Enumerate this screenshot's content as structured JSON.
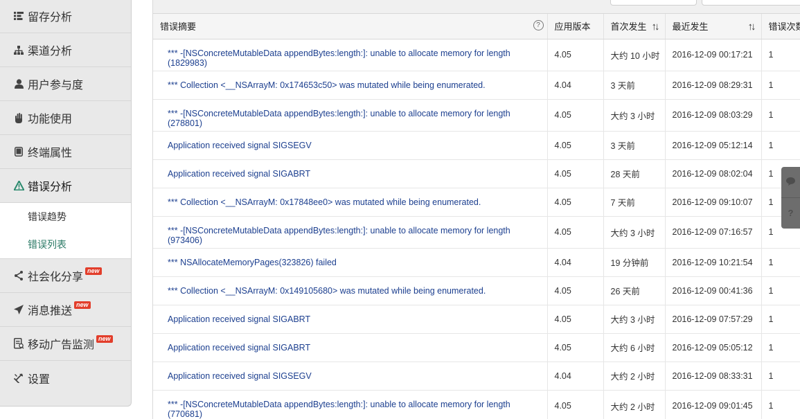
{
  "sidebar": {
    "items": [
      {
        "label": "留存分析",
        "icon": "retention-icon"
      },
      {
        "label": "渠道分析",
        "icon": "channel-icon"
      },
      {
        "label": "用户参与度",
        "icon": "user-icon"
      },
      {
        "label": "功能使用",
        "icon": "hand-icon"
      },
      {
        "label": "终端属性",
        "icon": "tablet-icon"
      },
      {
        "label": "错误分析",
        "icon": "warning-icon"
      }
    ],
    "subitems": [
      {
        "label": "错误趋势"
      },
      {
        "label": "错误列表"
      }
    ],
    "items2": [
      {
        "label": "社会化分享",
        "icon": "share-icon",
        "badge": "new"
      },
      {
        "label": "消息推送",
        "icon": "send-icon",
        "badge": "new"
      },
      {
        "label": "移动广告监测",
        "icon": "ad-monitor-icon",
        "badge": "new"
      },
      {
        "label": "设置",
        "icon": "tools-icon"
      }
    ]
  },
  "table": {
    "headers": {
      "summary": "错误摘要",
      "version": "应用版本",
      "first": "首次发生",
      "last": "最近发生",
      "count": "错误次数"
    },
    "rows": [
      {
        "summary": "*** -[NSConcreteMutableData appendBytes:length:]: unable to allocate memory for length (1829983)",
        "version": "4.05",
        "first": "大约 10 小时",
        "last": "2016-12-09 00:17:21",
        "count": "1"
      },
      {
        "summary": "*** Collection <__NSArrayM: 0x174653c50> was mutated while being enumerated.",
        "version": "4.04",
        "first": "3 天前",
        "last": "2016-12-09 08:29:31",
        "count": "1"
      },
      {
        "summary": "*** -[NSConcreteMutableData appendBytes:length:]: unable to allocate memory for length (278801)",
        "version": "4.05",
        "first": "大约 3 小时",
        "last": "2016-12-09 08:03:29",
        "count": "1"
      },
      {
        "summary": "Application received signal SIGSEGV",
        "version": "4.05",
        "first": "3 天前",
        "last": "2016-12-09 05:12:14",
        "count": "1"
      },
      {
        "summary": "Application received signal SIGABRT",
        "version": "4.05",
        "first": "28 天前",
        "last": "2016-12-09 08:02:04",
        "count": "1"
      },
      {
        "summary": "*** Collection <__NSArrayM: 0x17848ee0> was mutated while being enumerated.",
        "version": "4.05",
        "first": "7 天前",
        "last": "2016-12-09 09:10:07",
        "count": "1"
      },
      {
        "summary": "*** -[NSConcreteMutableData appendBytes:length:]: unable to allocate memory for length (973406)",
        "version": "4.05",
        "first": "大约 3 小时",
        "last": "2016-12-09 07:16:57",
        "count": "1"
      },
      {
        "summary": "*** NSAllocateMemoryPages(323826) failed",
        "version": "4.04",
        "first": "19 分钟前",
        "last": "2016-12-09 10:21:54",
        "count": "1"
      },
      {
        "summary": "*** Collection <__NSArrayM: 0x149105680> was mutated while being enumerated.",
        "version": "4.05",
        "first": "26 天前",
        "last": "2016-12-09 00:41:36",
        "count": "1"
      },
      {
        "summary": "Application received signal SIGABRT",
        "version": "4.05",
        "first": "大约 3 小时",
        "last": "2016-12-09 07:57:29",
        "count": "1"
      },
      {
        "summary": "Application received signal SIGABRT",
        "version": "4.05",
        "first": "大约 6 小时",
        "last": "2016-12-09 05:05:12",
        "count": "1"
      },
      {
        "summary": "Application received signal SIGSEGV",
        "version": "4.04",
        "first": "大约 2 小时",
        "last": "2016-12-09 08:33:31",
        "count": "1"
      },
      {
        "summary": "*** -[NSConcreteMutableData appendBytes:length:]: unable to allocate memory for length (770681)",
        "version": "4.05",
        "first": "大约 2 小时",
        "last": "2016-12-09 09:01:45",
        "count": "1"
      }
    ]
  },
  "float_tools": {
    "chat_icon": "chat-bubble-icon",
    "help_label": "?"
  },
  "colors": {
    "link": "#1c3f8f",
    "accent": "#2b8a6e",
    "badge": "#e23e2b"
  }
}
